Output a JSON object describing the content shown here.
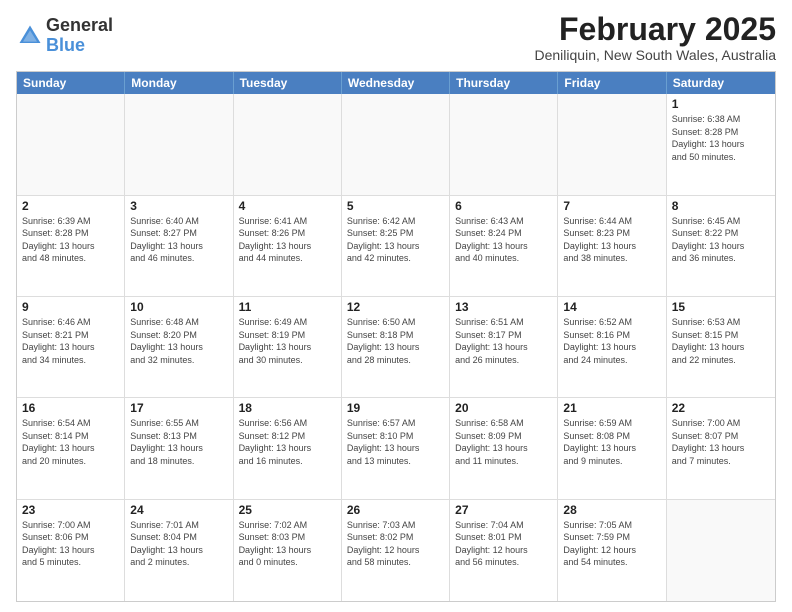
{
  "header": {
    "logo": {
      "general": "General",
      "blue": "Blue"
    },
    "title": "February 2025",
    "location": "Deniliquin, New South Wales, Australia"
  },
  "weekdays": [
    "Sunday",
    "Monday",
    "Tuesday",
    "Wednesday",
    "Thursday",
    "Friday",
    "Saturday"
  ],
  "weeks": [
    [
      {
        "day": "",
        "info": ""
      },
      {
        "day": "",
        "info": ""
      },
      {
        "day": "",
        "info": ""
      },
      {
        "day": "",
        "info": ""
      },
      {
        "day": "",
        "info": ""
      },
      {
        "day": "",
        "info": ""
      },
      {
        "day": "1",
        "info": "Sunrise: 6:38 AM\nSunset: 8:28 PM\nDaylight: 13 hours\nand 50 minutes."
      }
    ],
    [
      {
        "day": "2",
        "info": "Sunrise: 6:39 AM\nSunset: 8:28 PM\nDaylight: 13 hours\nand 48 minutes."
      },
      {
        "day": "3",
        "info": "Sunrise: 6:40 AM\nSunset: 8:27 PM\nDaylight: 13 hours\nand 46 minutes."
      },
      {
        "day": "4",
        "info": "Sunrise: 6:41 AM\nSunset: 8:26 PM\nDaylight: 13 hours\nand 44 minutes."
      },
      {
        "day": "5",
        "info": "Sunrise: 6:42 AM\nSunset: 8:25 PM\nDaylight: 13 hours\nand 42 minutes."
      },
      {
        "day": "6",
        "info": "Sunrise: 6:43 AM\nSunset: 8:24 PM\nDaylight: 13 hours\nand 40 minutes."
      },
      {
        "day": "7",
        "info": "Sunrise: 6:44 AM\nSunset: 8:23 PM\nDaylight: 13 hours\nand 38 minutes."
      },
      {
        "day": "8",
        "info": "Sunrise: 6:45 AM\nSunset: 8:22 PM\nDaylight: 13 hours\nand 36 minutes."
      }
    ],
    [
      {
        "day": "9",
        "info": "Sunrise: 6:46 AM\nSunset: 8:21 PM\nDaylight: 13 hours\nand 34 minutes."
      },
      {
        "day": "10",
        "info": "Sunrise: 6:48 AM\nSunset: 8:20 PM\nDaylight: 13 hours\nand 32 minutes."
      },
      {
        "day": "11",
        "info": "Sunrise: 6:49 AM\nSunset: 8:19 PM\nDaylight: 13 hours\nand 30 minutes."
      },
      {
        "day": "12",
        "info": "Sunrise: 6:50 AM\nSunset: 8:18 PM\nDaylight: 13 hours\nand 28 minutes."
      },
      {
        "day": "13",
        "info": "Sunrise: 6:51 AM\nSunset: 8:17 PM\nDaylight: 13 hours\nand 26 minutes."
      },
      {
        "day": "14",
        "info": "Sunrise: 6:52 AM\nSunset: 8:16 PM\nDaylight: 13 hours\nand 24 minutes."
      },
      {
        "day": "15",
        "info": "Sunrise: 6:53 AM\nSunset: 8:15 PM\nDaylight: 13 hours\nand 22 minutes."
      }
    ],
    [
      {
        "day": "16",
        "info": "Sunrise: 6:54 AM\nSunset: 8:14 PM\nDaylight: 13 hours\nand 20 minutes."
      },
      {
        "day": "17",
        "info": "Sunrise: 6:55 AM\nSunset: 8:13 PM\nDaylight: 13 hours\nand 18 minutes."
      },
      {
        "day": "18",
        "info": "Sunrise: 6:56 AM\nSunset: 8:12 PM\nDaylight: 13 hours\nand 16 minutes."
      },
      {
        "day": "19",
        "info": "Sunrise: 6:57 AM\nSunset: 8:10 PM\nDaylight: 13 hours\nand 13 minutes."
      },
      {
        "day": "20",
        "info": "Sunrise: 6:58 AM\nSunset: 8:09 PM\nDaylight: 13 hours\nand 11 minutes."
      },
      {
        "day": "21",
        "info": "Sunrise: 6:59 AM\nSunset: 8:08 PM\nDaylight: 13 hours\nand 9 minutes."
      },
      {
        "day": "22",
        "info": "Sunrise: 7:00 AM\nSunset: 8:07 PM\nDaylight: 13 hours\nand 7 minutes."
      }
    ],
    [
      {
        "day": "23",
        "info": "Sunrise: 7:00 AM\nSunset: 8:06 PM\nDaylight: 13 hours\nand 5 minutes."
      },
      {
        "day": "24",
        "info": "Sunrise: 7:01 AM\nSunset: 8:04 PM\nDaylight: 13 hours\nand 2 minutes."
      },
      {
        "day": "25",
        "info": "Sunrise: 7:02 AM\nSunset: 8:03 PM\nDaylight: 13 hours\nand 0 minutes."
      },
      {
        "day": "26",
        "info": "Sunrise: 7:03 AM\nSunset: 8:02 PM\nDaylight: 12 hours\nand 58 minutes."
      },
      {
        "day": "27",
        "info": "Sunrise: 7:04 AM\nSunset: 8:01 PM\nDaylight: 12 hours\nand 56 minutes."
      },
      {
        "day": "28",
        "info": "Sunrise: 7:05 AM\nSunset: 7:59 PM\nDaylight: 12 hours\nand 54 minutes."
      },
      {
        "day": "",
        "info": ""
      }
    ]
  ]
}
